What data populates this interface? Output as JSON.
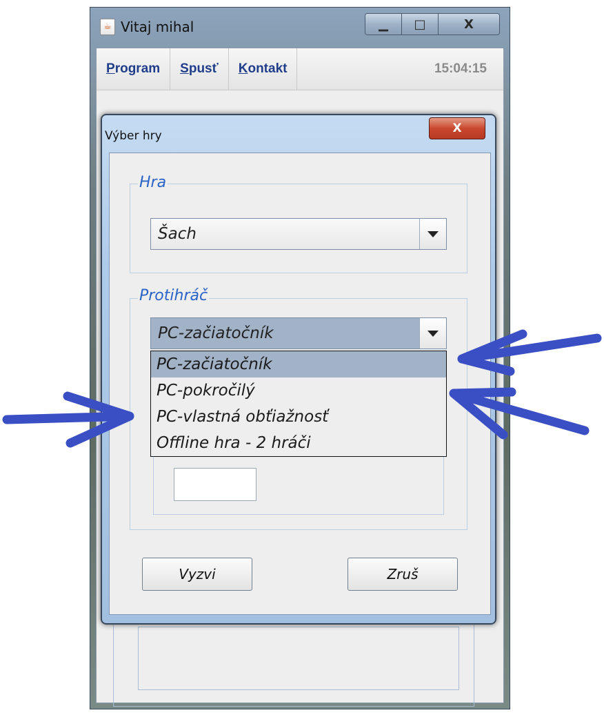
{
  "main_window": {
    "title": "Vitaj mihal",
    "menu": [
      {
        "prefix": "",
        "hotkey": "P",
        "rest": "rogram"
      },
      {
        "prefix": "",
        "hotkey": "S",
        "rest": "pusť"
      },
      {
        "prefix": "",
        "hotkey": "K",
        "rest": "ontakt"
      }
    ],
    "clock": "15:04:15",
    "controls": {
      "minimize": "▁",
      "maximize": "□",
      "close": "X"
    }
  },
  "dialog": {
    "title": "Výber hry",
    "close": "X",
    "game_group": {
      "label": "Hra",
      "selected": "Šach"
    },
    "opponent_group": {
      "label": "Protihráč",
      "selected": "PC-začiatočník",
      "options": [
        "PC-začiatočník",
        "PC-pokročilý",
        "PC-vlastná obťiažnosť",
        "Offline hra - 2 hráči"
      ]
    },
    "buttons": {
      "challenge": "Vyzvi",
      "cancel": "Zruš"
    }
  },
  "annotation_color": "#3a4fc4"
}
